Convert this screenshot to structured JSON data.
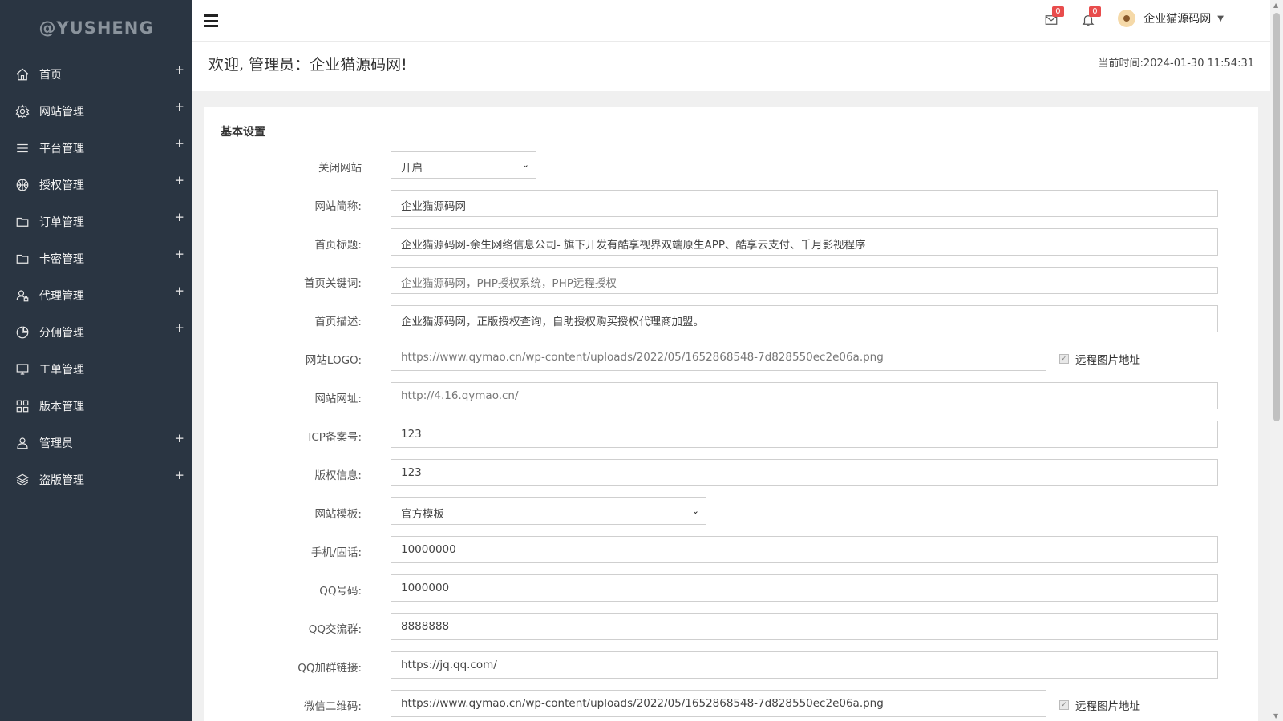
{
  "brand": "@YUSHENG",
  "sidebar": {
    "items": [
      {
        "label": "首页",
        "icon": "home-icon",
        "expandable": true
      },
      {
        "label": "网站管理",
        "icon": "gear-icon",
        "expandable": true
      },
      {
        "label": "平台管理",
        "icon": "list-icon",
        "expandable": true
      },
      {
        "label": "授权管理",
        "icon": "basketball-icon",
        "expandable": true
      },
      {
        "label": "订单管理",
        "icon": "folder-icon",
        "expandable": true
      },
      {
        "label": "卡密管理",
        "icon": "folder-icon",
        "expandable": true
      },
      {
        "label": "代理管理",
        "icon": "user-lock-icon",
        "expandable": true
      },
      {
        "label": "分佣管理",
        "icon": "pie-icon",
        "expandable": true
      },
      {
        "label": "工单管理",
        "icon": "monitor-icon",
        "expandable": false
      },
      {
        "label": "版本管理",
        "icon": "grid-icon",
        "expandable": false
      },
      {
        "label": "管理员",
        "icon": "user-icon",
        "expandable": true
      },
      {
        "label": "盗版管理",
        "icon": "layers-icon",
        "expandable": true
      }
    ],
    "plus": "+"
  },
  "topbar": {
    "mail_count": "0",
    "bell_count": "0",
    "user_name": "企业猫源码网",
    "caret": "▼"
  },
  "header": {
    "welcome": "欢迎, 管理员：企业猫源码网!",
    "time_label": "当前时间:",
    "time_value": "2024-01-30 11:54:31"
  },
  "panel": {
    "title": "基本设置",
    "fields": [
      {
        "label": "关闭网站",
        "value": "开启",
        "type": "select"
      },
      {
        "label": "网站简称:",
        "value": "企业猫源码网",
        "type": "text"
      },
      {
        "label": "首页标题:",
        "value": "企业猫源码网-余生网络信息公司- 旗下开发有酷享视界双端原生APP、酷享云支付、千月影视程序",
        "type": "text"
      },
      {
        "label": "首页关键词:",
        "value": "企业猫源码网，PHP授权系统，PHP远程授权",
        "type": "text"
      },
      {
        "label": "首页描述:",
        "value": "企业猫源码网，正版授权查询，自助授权购买授权代理商加盟。",
        "type": "text"
      },
      {
        "label": "网站LOGO:",
        "value": "https://www.qymao.cn/wp-content/uploads/2022/05/1652868548-7d828550ec2e06a.png",
        "type": "text-remote",
        "remote_label": "远程图片地址"
      },
      {
        "label": "网站网址:",
        "value": "http://4.16.qymao.cn/",
        "type": "text"
      },
      {
        "label": "ICP备案号:",
        "value": "123",
        "type": "text"
      },
      {
        "label": "版权信息:",
        "value": "123",
        "type": "text"
      },
      {
        "label": "网站模板:",
        "value": "官方模板",
        "type": "select"
      },
      {
        "label": "手机/固话:",
        "value": "10000000",
        "type": "text"
      },
      {
        "label": "QQ号码:",
        "value": "1000000",
        "type": "text"
      },
      {
        "label": "QQ交流群:",
        "value": "8888888",
        "type": "text"
      },
      {
        "label": "QQ加群链接:",
        "value": "https://jq.qq.com/",
        "type": "text"
      },
      {
        "label": "微信二维码:",
        "value": "https://www.qymao.cn/wp-content/uploads/2022/05/1652868548-7d828550ec2e06a.png",
        "type": "text-remote",
        "remote_label": "远程图片地址"
      }
    ]
  }
}
